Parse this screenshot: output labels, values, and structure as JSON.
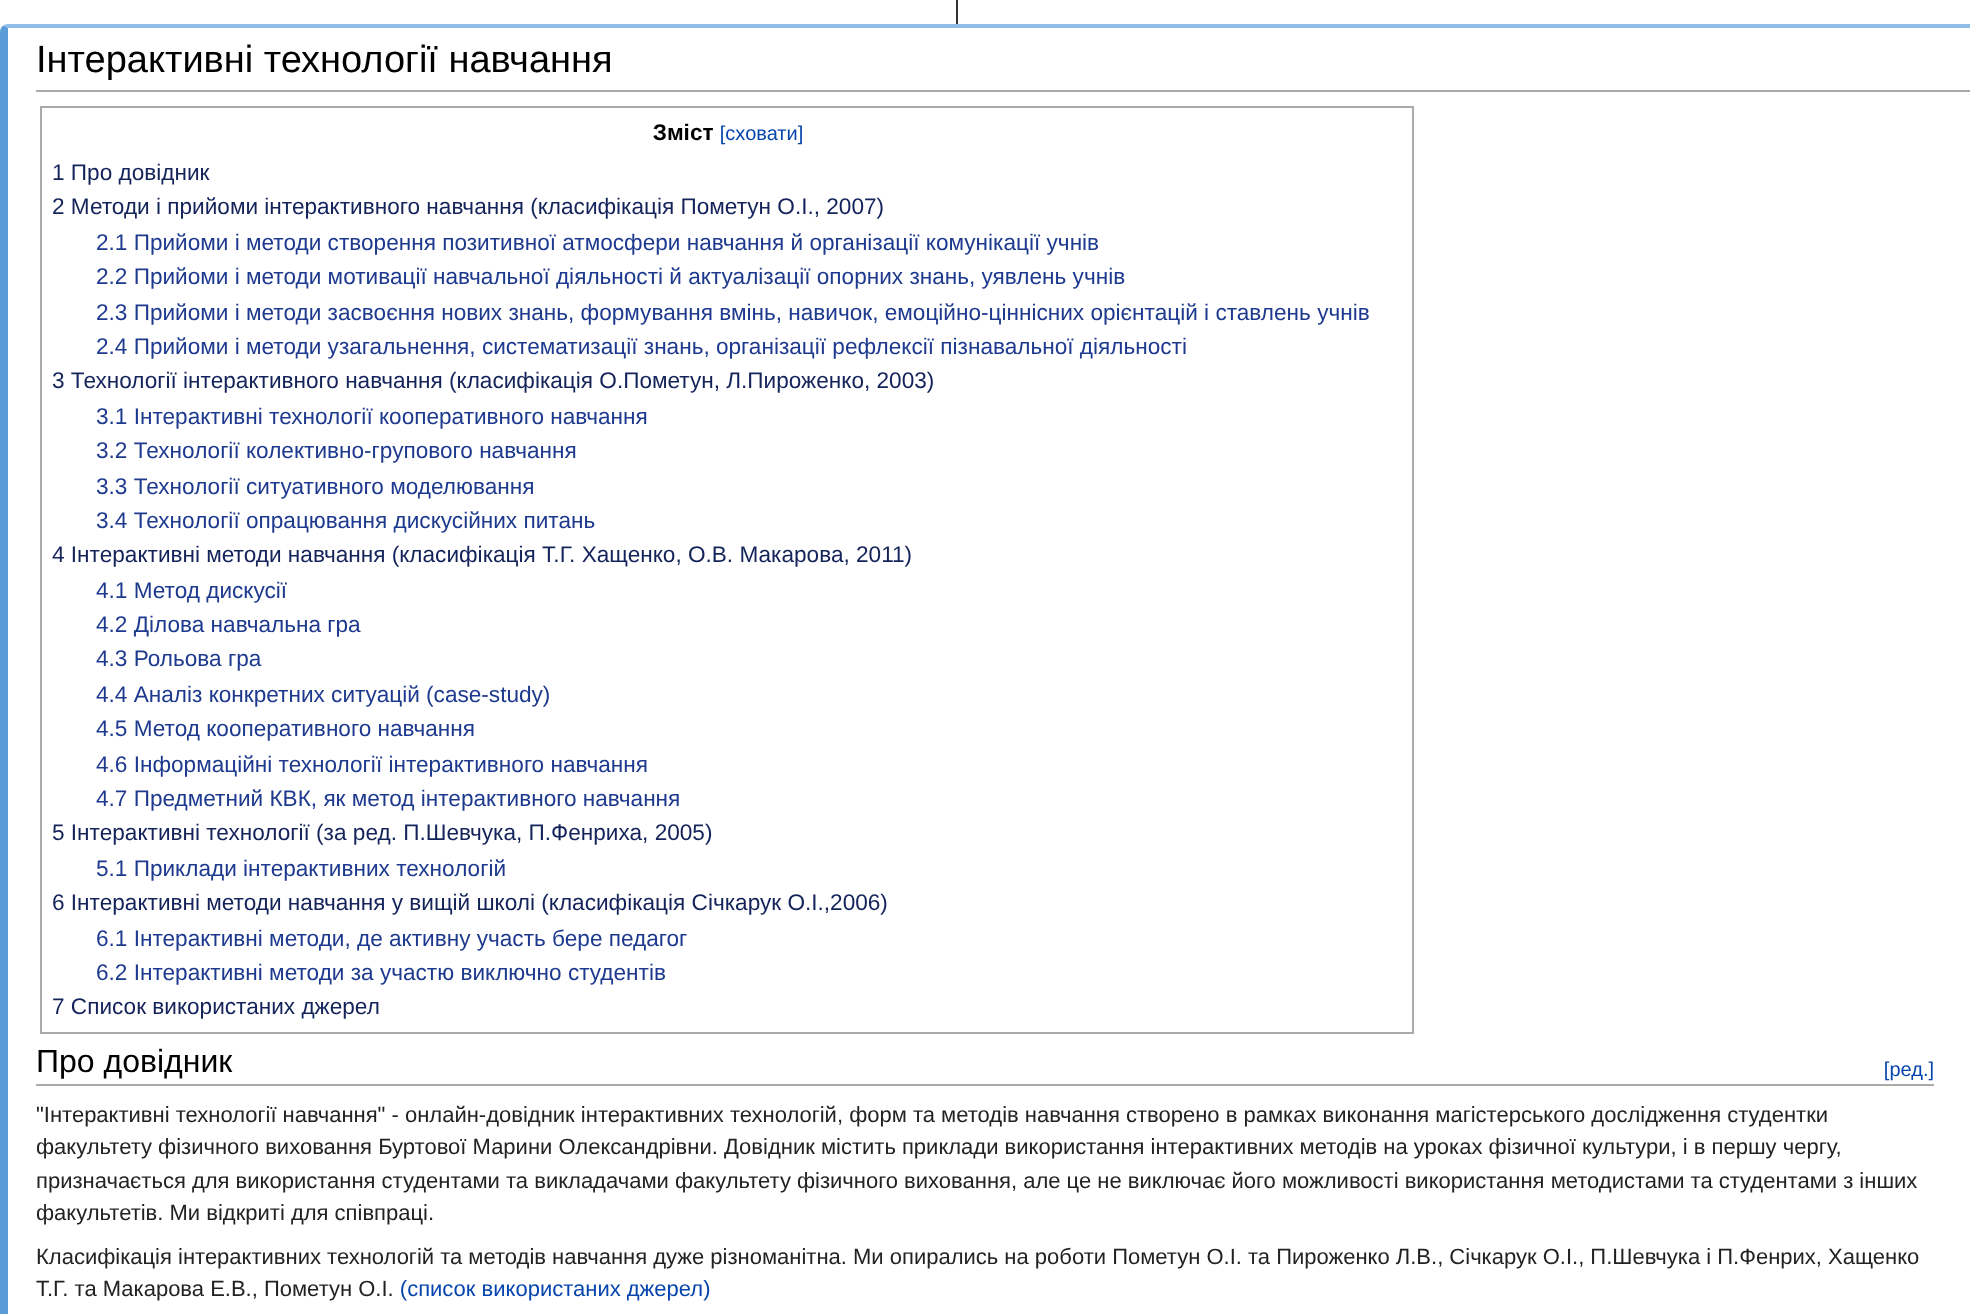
{
  "page": {
    "title": "Інтерактивні технології навчання"
  },
  "toc": {
    "title": "Зміст",
    "toggle": "[сховати]",
    "items": [
      {
        "label": "1 Про довідник"
      },
      {
        "label": "2 Методи і прийоми інтерактивного навчання (класифікація Пометун О.І., 2007)",
        "children": [
          {
            "label": "2.1 Прийоми і методи створення позитивної атмосфери навчання й організації комунікації учнів"
          },
          {
            "label": "2.2 Прийоми і методи мотивації навчальної діяльності й актуалізації опорних знань, уявлень учнів"
          },
          {
            "label": "2.3 Прийоми і методи засвоєння нових знань, формування вмінь, навичок, емоційно-ціннісних орієнтацій і ставлень учнів"
          },
          {
            "label": "2.4 Прийоми і методи узагальнення, систематизації знань, організації рефлексії пізнавальної діяльності"
          }
        ]
      },
      {
        "label": "3 Технології інтерактивного навчання (класифікація О.Пометун, Л.Пироженко, 2003)",
        "children": [
          {
            "label": "3.1 Інтерактивні технології кооперативного навчання"
          },
          {
            "label": "3.2 Технології колективно-групового навчання"
          },
          {
            "label": "3.3 Технології ситуативного моделювання"
          },
          {
            "label": "3.4 Технології опрацювання дискусійних питань"
          }
        ]
      },
      {
        "label": "4 Інтерактивні методи навчання (класифікація Т.Г. Хащенко, О.В. Макарова, 2011)",
        "children": [
          {
            "label": "4.1 Метод дискусії"
          },
          {
            "label": "4.2 Ділова навчальна гра"
          },
          {
            "label": "4.3 Рольова гра"
          },
          {
            "label": "4.4 Аналіз конкретних ситуацій (case-study)"
          },
          {
            "label": "4.5 Метод кооперативного навчання"
          },
          {
            "label": "4.6 Інформаційні технології інтерактивного навчання"
          },
          {
            "label": "4.7 Предметний КВК, як метод інтерактивного навчання"
          }
        ]
      },
      {
        "label": "5 Інтерактивні технології (за ред. П.Шевчука, П.Фенриха, 2005)",
        "children": [
          {
            "label": "5.1 Приклади інтерактивних технологій"
          }
        ]
      },
      {
        "label": "6 Інтерактивні методи навчання у вищій школі (класифікація Січкарук О.І.,2006)",
        "children": [
          {
            "label": "6.1 Інтерактивні методи, де активну участь бере педагог"
          },
          {
            "label": "6.2 Інтерактивні методи за участю виключно студентів"
          }
        ]
      },
      {
        "label": "7 Список використаних джерел"
      }
    ]
  },
  "section": {
    "heading": "Про довідник",
    "edit_link": "[ред.]",
    "paragraphs": [
      {
        "text": "\"Інтерактивні технології навчання\" - онлайн-довідник інтерактивних технологій, форм та методів навчання створено в рамках виконання магістерського дослідження студентки факультету фізичного виховання Буртової Марини Олександрівни. Довідник містить приклади використання інтерактивних методів на уроках фізичної культури, і в першу чергу, призначається для використання студентами та викладачами факультету фізичного виховання, але це не виключає його можливості використання методистами та студентами з інших факультетів. Ми відкриті для співпраці."
      },
      {
        "text": "Класифікація інтерактивних технологій та методів навчання дуже різноманітна. Ми опирались на роботи Пометун О.І. та Пироженко Л.В., Січкарук О.І., П.Шевчука і П.Фенрих, Хащенко Т.Г. та Макарова Е.В., Пометун О.І.",
        "link": "(список використаних джерел)"
      }
    ]
  }
}
